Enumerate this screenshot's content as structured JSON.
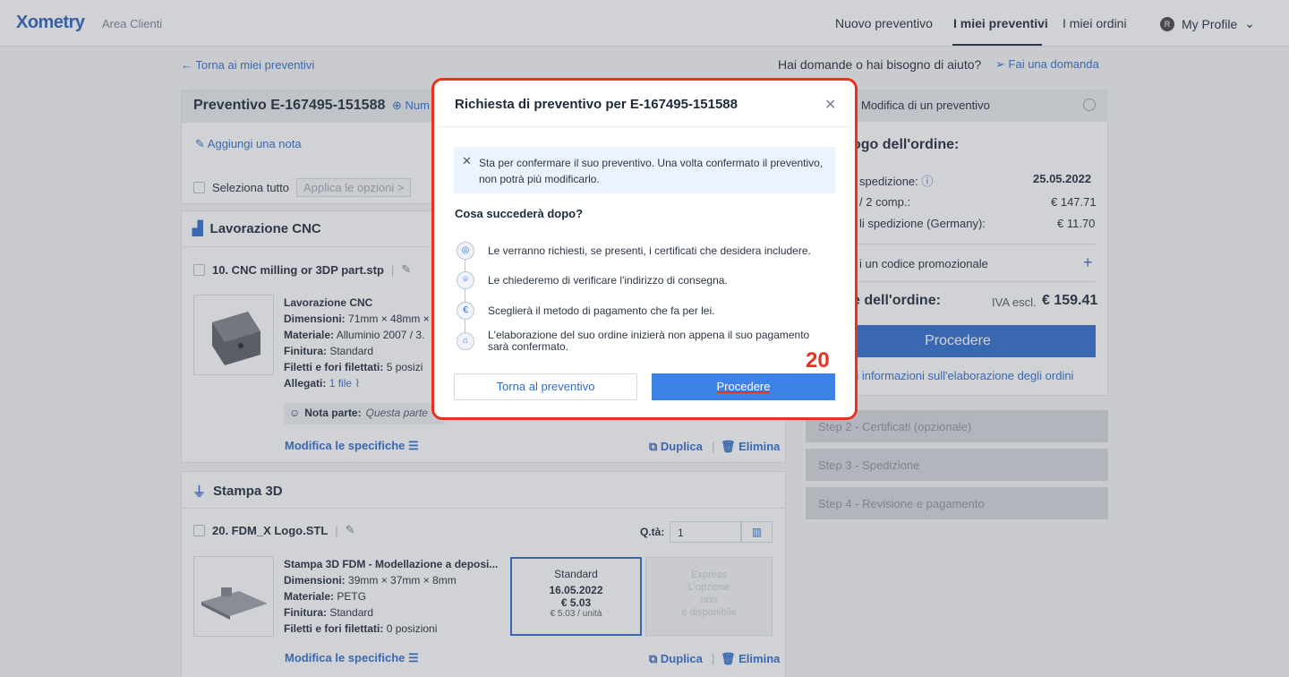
{
  "nav": {
    "logo": "Xometry",
    "area": "Area Clienti",
    "links": [
      "Nuovo preventivo",
      "I miei preventivi",
      "I miei ordini"
    ],
    "profile": "My Profile",
    "avatar_letter": "R"
  },
  "subbar": {
    "back": "← Torna ai miei preventivi",
    "help": "Hai domande o hai bisogno di aiuto?",
    "ask": "Fai una domanda"
  },
  "quote": {
    "title": "Preventivo E-167495-151588",
    "num_link": "Num",
    "add_note": "Aggiungi una nota",
    "select_all": "Seleziona tutto",
    "apply": "Applica le opzioni >"
  },
  "cnc": {
    "section": "Lavorazione CNC",
    "part": "10. CNC milling or 3DP part.stp",
    "specs": {
      "process": "Lavorazione CNC",
      "dim_label": "Dimensioni:",
      "dim": "71mm × 48mm ×",
      "mat_label": "Materiale:",
      "mat": "Alluminio 2007 / 3.",
      "fin_label": "Finitura:",
      "fin": "Standard",
      "thr_label": "Filetti e fori filettati:",
      "thr": "5 posizi",
      "att_label": "Allegati:",
      "att": "1 file"
    },
    "note_label": "Nota parte:",
    "note_value": "Questa parte",
    "modify": "Modifica le specifiche",
    "duplicate": "Duplica",
    "delete": "Elimina"
  },
  "printing": {
    "section": "Stampa 3D",
    "part": "20. FDM_X Logo.STL",
    "qty_label": "Q.tà:",
    "qty": "1",
    "specs": {
      "process": "Stampa 3D FDM - Modellazione a deposi...",
      "dim_label": "Dimensioni:",
      "dim": "39mm × 37mm × 8mm",
      "mat_label": "Materiale:",
      "mat": "PETG",
      "fin_label": "Finitura:",
      "fin": "Standard",
      "thr_label": "Filetti e fori filettati:",
      "thr": "0 posizioni"
    },
    "standard": {
      "label": "Standard",
      "date": "16.05.2022",
      "price": "€ 5.03",
      "unit": "€ 5.03 / unità"
    },
    "express": {
      "label": "Express",
      "line1": "L'opzione",
      "line2": "non",
      "line3": "è disponibile"
    },
    "modify": "Modifica le specifiche",
    "duplicate": "Duplica",
    "delete": "Elimina"
  },
  "summary": {
    "step1": "Modifica di un preventivo",
    "title": "ogo dell'ordine:",
    "ship_label": "spedizione:",
    "ship_date": "25.05.2022",
    "comp_label": "/ 2 comp.:",
    "comp_val": "€ 147.71",
    "cost_label": "li spedizione (Germany):",
    "cost_val": "€ 11.70",
    "promo": "i un codice promozionale",
    "total_label": "e dell'ordine:",
    "iva": "IVA escl.",
    "total": "€ 159.41",
    "proceed": "Procedere",
    "info": "ri informazioni sull'elaborazione degli ordini",
    "steps": [
      "Step 2 - Certificati (opzionale)",
      "Step 3 - Spedizione",
      "Step 4 - Revisione e pagamento"
    ]
  },
  "modal": {
    "title": "Richiesta di preventivo per E-167495-151588",
    "alert": "Sta per confermare il suo preventivo. Una volta confermato il preventivo, non potrà più modificarlo.",
    "subtitle": "Cosa succederà dopo?",
    "steps": [
      "Le verranno richiesti, se presenti, i certificati che desidera includere.",
      "Le chiederemo di verificare l'indirizzo di consegna.",
      "Sceglierà il metodo di pagamento che fa per lei.",
      "L'elaborazione del suo ordine inizierà non appena il suo pagamento sarà confermato."
    ],
    "back_btn": "Torna al preventivo",
    "proceed_btn": "Procedere",
    "annotation": "20"
  },
  "colors": {
    "accent": "#2f6dcc",
    "highlight": "#e8321f"
  }
}
